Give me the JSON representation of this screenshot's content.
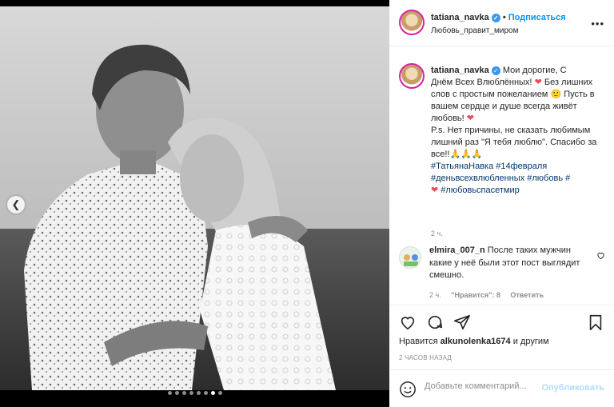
{
  "post": {
    "username": "tatiana_navka",
    "follow_label": "Подписаться",
    "separator": "•",
    "location": "Любовь_правит_миром",
    "carousel": {
      "total": 8,
      "active": 7
    }
  },
  "caption": {
    "username": "tatiana_navka",
    "lines": [
      "Мои дорогие, С",
      "Днём Всех Влюблённых!",
      "Без лишних слов с простым пожеланием",
      "Пусть в вашем сердце и душе всегда живёт любовь!"
    ],
    "ps": "P.s. Нет причины, не сказать любимым лишний раз \"Я тебя люблю\". Спасибо за все!!🙏🙏🙏",
    "hashtags_1": "#ТатьянаНавка #14февраля",
    "hashtags_2": "#деньвсехвлюбленных #любовь #",
    "hashtags_3": "#любовьспасетмир",
    "time": "2 ч."
  },
  "comment": {
    "username": "elmira_007_n",
    "text": "После таких мужчин какие у неё были этот пост выглядит смешно.",
    "time": "2 ч.",
    "likes": "\"Нравится\": 8",
    "reply_label": "Ответить"
  },
  "likes": {
    "prefix": "Нравится",
    "user": "alkunolenka1674",
    "suffix": "и другим"
  },
  "timestamp": "2 ЧАСОВ НАЗАД",
  "add_comment": {
    "placeholder": "Добавьте комментарий...",
    "publish_label": "Опубликовать"
  },
  "icons": {
    "like": "heart-icon",
    "comment": "comment-icon",
    "share": "share-icon",
    "save": "bookmark-icon",
    "emoji": "emoji-icon",
    "more": "more-icon",
    "verified": "verified-badge-icon"
  },
  "colors": {
    "link": "#0095f6",
    "hashtag": "#00376b",
    "heart": "#ed4956",
    "muted": "#8e8e8e",
    "publish_disabled": "#b3dbff"
  }
}
